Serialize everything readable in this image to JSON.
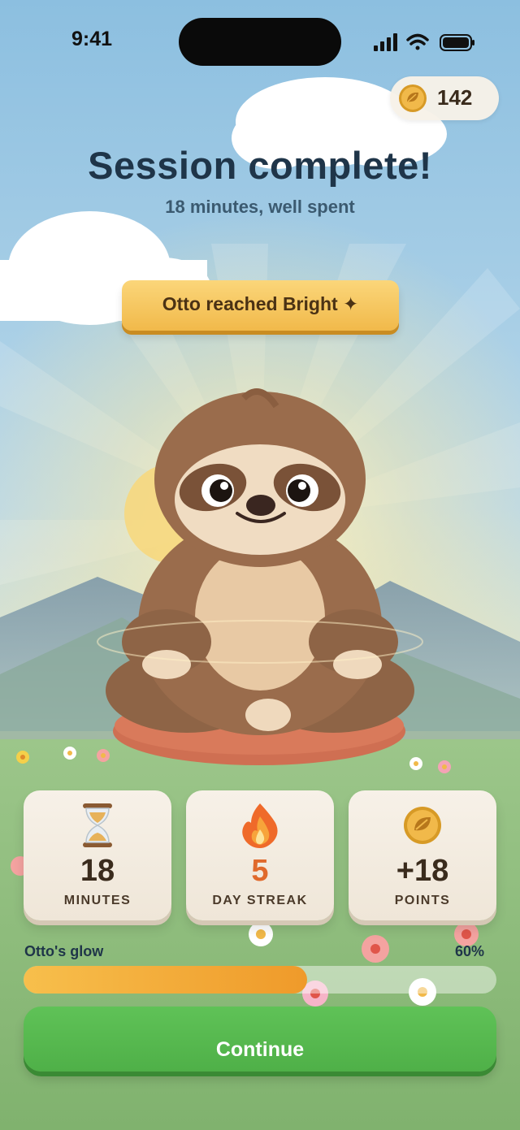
{
  "status_bar": {
    "time": "9:41"
  },
  "coins": {
    "count": "142",
    "icon": "leaf-coin-icon"
  },
  "header": {
    "title": "Session complete!",
    "subtitle": "18 minutes, well spent"
  },
  "level_banner": {
    "text": "Otto reached Bright ✦"
  },
  "stats": [
    {
      "icon": "hourglass-icon",
      "value": "18",
      "label": "MINUTES",
      "value_color": "#3a2b1c"
    },
    {
      "icon": "flame-icon",
      "value": "5",
      "label": "DAY STREAK",
      "value_color": "#e06a2c"
    },
    {
      "icon": "leaf-coin-icon",
      "value": "+18",
      "label": "POINTS",
      "value_color": "#3a2b1c"
    }
  ],
  "glow": {
    "label": "Otto's glow",
    "percent_text": "60%",
    "progress": 0.6
  },
  "continue_button": {
    "label": "Continue"
  },
  "colors": {
    "accent_green": "#52b64a",
    "gold": "#f3c04f",
    "sky": "#8cbfe0",
    "headline": "#1f3549"
  }
}
